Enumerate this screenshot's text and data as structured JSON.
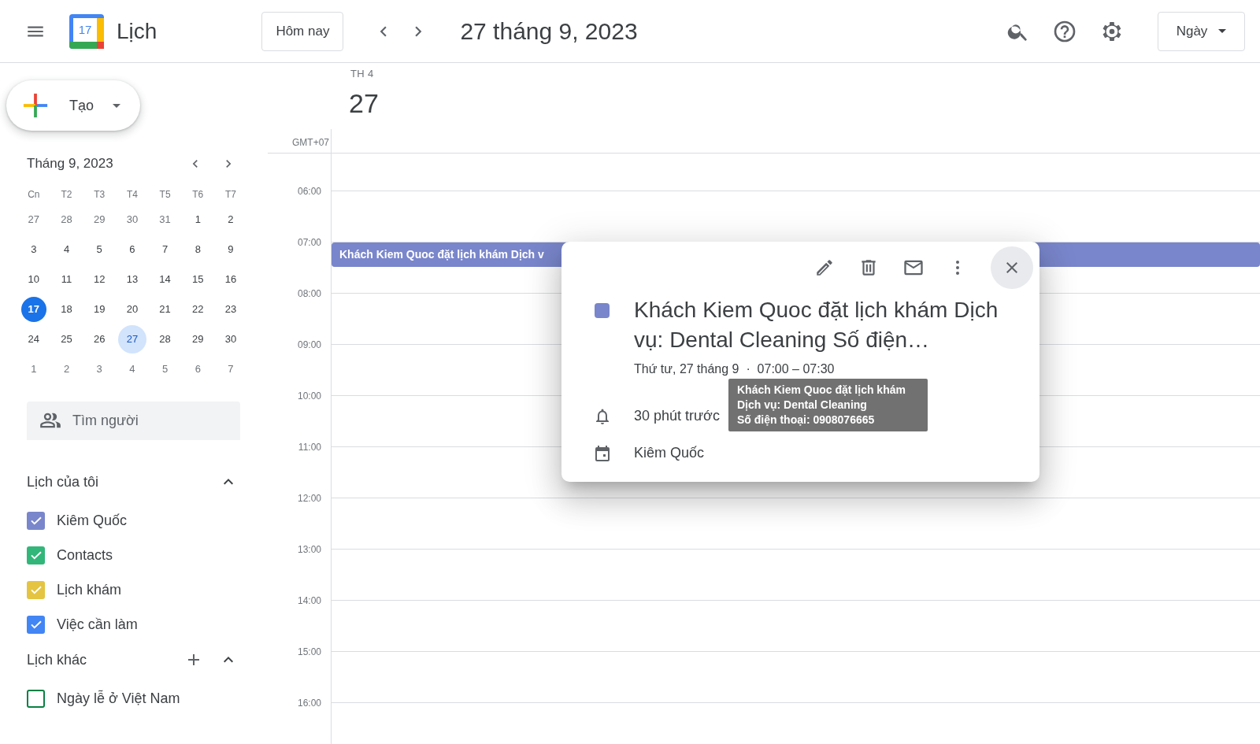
{
  "header": {
    "app_title": "Lịch",
    "logo_day": "17",
    "today_button": "Hôm nay",
    "date_title": "27 tháng 9, 2023",
    "view_dropdown": "Ngày"
  },
  "sidebar": {
    "create_button": "Tạo",
    "mini_calendar": {
      "title": "Tháng 9, 2023",
      "weekdays": [
        "Cn",
        "T2",
        "T3",
        "T4",
        "T5",
        "T6",
        "T7"
      ],
      "weeks": [
        [
          {
            "label": "27",
            "other_month": true,
            "today": false,
            "selected": false
          },
          {
            "label": "28",
            "other_month": true,
            "today": false,
            "selected": false
          },
          {
            "label": "29",
            "other_month": true,
            "today": false,
            "selected": false
          },
          {
            "label": "30",
            "other_month": true,
            "today": false,
            "selected": false
          },
          {
            "label": "31",
            "other_month": true,
            "today": false,
            "selected": false
          },
          {
            "label": "1",
            "other_month": false,
            "today": false,
            "selected": false
          },
          {
            "label": "2",
            "other_month": false,
            "today": false,
            "selected": false
          }
        ],
        [
          {
            "label": "3",
            "other_month": false,
            "today": false,
            "selected": false
          },
          {
            "label": "4",
            "other_month": false,
            "today": false,
            "selected": false
          },
          {
            "label": "5",
            "other_month": false,
            "today": false,
            "selected": false
          },
          {
            "label": "6",
            "other_month": false,
            "today": false,
            "selected": false
          },
          {
            "label": "7",
            "other_month": false,
            "today": false,
            "selected": false
          },
          {
            "label": "8",
            "other_month": false,
            "today": false,
            "selected": false
          },
          {
            "label": "9",
            "other_month": false,
            "today": false,
            "selected": false
          }
        ],
        [
          {
            "label": "10",
            "other_month": false,
            "today": false,
            "selected": false
          },
          {
            "label": "11",
            "other_month": false,
            "today": false,
            "selected": false
          },
          {
            "label": "12",
            "other_month": false,
            "today": false,
            "selected": false
          },
          {
            "label": "13",
            "other_month": false,
            "today": false,
            "selected": false
          },
          {
            "label": "14",
            "other_month": false,
            "today": false,
            "selected": false
          },
          {
            "label": "15",
            "other_month": false,
            "today": false,
            "selected": false
          },
          {
            "label": "16",
            "other_month": false,
            "today": false,
            "selected": false
          }
        ],
        [
          {
            "label": "17",
            "other_month": false,
            "today": true,
            "selected": false
          },
          {
            "label": "18",
            "other_month": false,
            "today": false,
            "selected": false
          },
          {
            "label": "19",
            "other_month": false,
            "today": false,
            "selected": false
          },
          {
            "label": "20",
            "other_month": false,
            "today": false,
            "selected": false
          },
          {
            "label": "21",
            "other_month": false,
            "today": false,
            "selected": false
          },
          {
            "label": "22",
            "other_month": false,
            "today": false,
            "selected": false
          },
          {
            "label": "23",
            "other_month": false,
            "today": false,
            "selected": false
          }
        ],
        [
          {
            "label": "24",
            "other_month": false,
            "today": false,
            "selected": false
          },
          {
            "label": "25",
            "other_month": false,
            "today": false,
            "selected": false
          },
          {
            "label": "26",
            "other_month": false,
            "today": false,
            "selected": false
          },
          {
            "label": "27",
            "other_month": false,
            "today": false,
            "selected": true
          },
          {
            "label": "28",
            "other_month": false,
            "today": false,
            "selected": false
          },
          {
            "label": "29",
            "other_month": false,
            "today": false,
            "selected": false
          },
          {
            "label": "30",
            "other_month": false,
            "today": false,
            "selected": false
          }
        ],
        [
          {
            "label": "1",
            "other_month": true,
            "today": false,
            "selected": false
          },
          {
            "label": "2",
            "other_month": true,
            "today": false,
            "selected": false
          },
          {
            "label": "3",
            "other_month": true,
            "today": false,
            "selected": false
          },
          {
            "label": "4",
            "other_month": true,
            "today": false,
            "selected": false
          },
          {
            "label": "5",
            "other_month": true,
            "today": false,
            "selected": false
          },
          {
            "label": "6",
            "other_month": true,
            "today": false,
            "selected": false
          },
          {
            "label": "7",
            "other_month": true,
            "today": false,
            "selected": false
          }
        ]
      ]
    },
    "people_search": {
      "placeholder": "Tìm người"
    },
    "my_calendars": {
      "title": "Lịch của tôi",
      "items": [
        {
          "label": "Kiêm Quốc",
          "checked": true,
          "color": "#7986cb"
        },
        {
          "label": "Contacts",
          "checked": true,
          "color": "#33b679"
        },
        {
          "label": "Lịch khám",
          "checked": true,
          "color": "#e4c441"
        },
        {
          "label": "Việc cần làm",
          "checked": true,
          "color": "#4285f4"
        }
      ]
    },
    "other_calendars": {
      "title": "Lịch khác",
      "items": [
        {
          "label": "Ngày lễ ở Việt Nam",
          "checked": false,
          "color": "#0b8043"
        }
      ]
    }
  },
  "day_view": {
    "weekday": "TH 4",
    "day": "27",
    "timezone": "GMT+07",
    "hours": [
      "06:00",
      "07:00",
      "08:00",
      "09:00",
      "10:00",
      "11:00",
      "12:00",
      "13:00",
      "14:00",
      "15:00",
      "16:00"
    ],
    "events": [
      {
        "title": "Khách Kiem Quoc đặt lịch khám Dịch v",
        "color": "#7986cb"
      }
    ]
  },
  "event_popup": {
    "title": "Khách Kiem Quoc đặt lịch khám Dịch vụ: Dental Cleaning Số điện…",
    "color": "#7986cb",
    "when": "Thứ tư, 27 tháng 9  ·  07:00 – 07:30",
    "reminder": "30 phút trước",
    "calendar": "Kiêm Quốc"
  },
  "tooltip": {
    "lines": [
      "Khách Kiem Quoc đặt lịch khám",
      "Dịch vụ: Dental Cleaning",
      "Số điện thoại: 0908076665"
    ]
  }
}
